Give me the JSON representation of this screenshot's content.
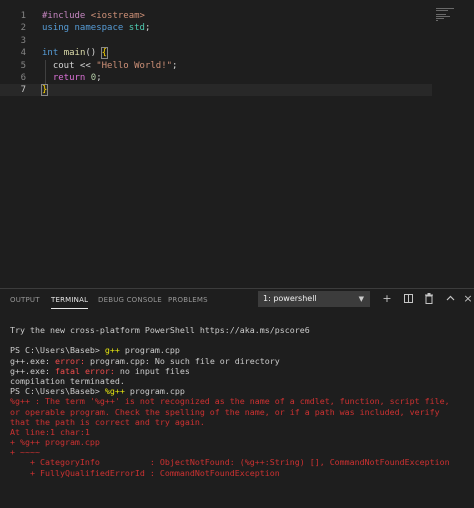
{
  "editor": {
    "lines": [
      {
        "number": "1",
        "segments": [
          {
            "text": "#include ",
            "class": "tok-pre"
          },
          {
            "text": "<iostream>",
            "class": "tok-str"
          }
        ]
      },
      {
        "number": "2",
        "segments": [
          {
            "text": "using ",
            "class": "tok-kw"
          },
          {
            "text": "namespace ",
            "class": "tok-kw"
          },
          {
            "text": "std",
            "class": "tok-ns"
          },
          {
            "text": ";",
            "class": ""
          }
        ]
      },
      {
        "number": "3",
        "segments": []
      },
      {
        "number": "4",
        "segments": [
          {
            "text": "int ",
            "class": "tok-ty"
          },
          {
            "text": "main",
            "class": "tok-fn"
          },
          {
            "text": "() ",
            "class": ""
          },
          {
            "text": "{",
            "class": "tok-br cursor-brace"
          }
        ]
      },
      {
        "number": "5",
        "segments": [
          {
            "text": "  cout << ",
            "class": ""
          },
          {
            "text": "\"Hello World!\"",
            "class": "tok-str"
          },
          {
            "text": ";",
            "class": ""
          }
        ]
      },
      {
        "number": "6",
        "segments": [
          {
            "text": "  return ",
            "class": "tok-br2"
          },
          {
            "text": "0",
            "class": "tok-num"
          },
          {
            "text": ";",
            "class": ""
          }
        ]
      },
      {
        "number": "7",
        "segments": [
          {
            "text": "}",
            "class": "tok-br cursor-brace"
          }
        ]
      }
    ],
    "active_line": "7"
  },
  "panel": {
    "tabs": [
      {
        "id": "output",
        "label": "OUTPUT",
        "active": false
      },
      {
        "id": "terminal",
        "label": "TERMINAL",
        "active": true
      },
      {
        "id": "debug-console",
        "label": "DEBUG CONSOLE",
        "active": false
      },
      {
        "id": "problems",
        "label": "PROBLEMS",
        "active": false
      }
    ],
    "terminal_select": "1: powershell",
    "icons": [
      "chevron-down-icon",
      "add-icon",
      "split-terminal-icon",
      "trash-icon",
      "maximize-icon",
      "close-icon"
    ]
  },
  "terminal": {
    "lines": [
      {
        "segments": [
          {
            "text": "Try the new cross-platform PowerShell https://aka.ms/pscore6",
            "class": ""
          }
        ]
      },
      {
        "segments": [
          {
            "text": "",
            "class": ""
          }
        ]
      },
      {
        "segments": [
          {
            "text": "PS C:\\Users\\Baseb> ",
            "class": ""
          },
          {
            "text": "g++",
            "class": "c-yellow"
          },
          {
            "text": " program.cpp",
            "class": ""
          }
        ]
      },
      {
        "segments": [
          {
            "text": "g++.exe: ",
            "class": ""
          },
          {
            "text": "error: ",
            "class": "c-err"
          },
          {
            "text": "program.cpp: No such file or directory",
            "class": ""
          }
        ]
      },
      {
        "segments": [
          {
            "text": "g++.exe: ",
            "class": ""
          },
          {
            "text": "fatal error: ",
            "class": "c-err"
          },
          {
            "text": "no input files",
            "class": ""
          }
        ]
      },
      {
        "segments": [
          {
            "text": "compilation terminated.",
            "class": ""
          }
        ]
      },
      {
        "segments": [
          {
            "text": "PS C:\\Users\\Baseb> ",
            "class": ""
          },
          {
            "text": "%g++",
            "class": "c-yellow"
          },
          {
            "text": " program.cpp",
            "class": ""
          }
        ]
      },
      {
        "wrap": true,
        "segments": [
          {
            "text": "%g++ : The term '%g++' is not recognized as the name of a cmdlet, function, script file, or operable program. Check the spelling of the name, or if a path was included, verify that the path is correct and try again.",
            "class": "c-red"
          }
        ]
      },
      {
        "segments": [
          {
            "text": "At line:1 char:1",
            "class": "c-red"
          }
        ]
      },
      {
        "segments": [
          {
            "text": "+ %g++ program.cpp",
            "class": "c-red"
          }
        ]
      },
      {
        "segments": [
          {
            "text": "+ ~~~~",
            "class": "c-red"
          }
        ]
      },
      {
        "segments": [
          {
            "text": "    + CategoryInfo          : ObjectNotFound: (%g++:String) [], CommandNotFoundException",
            "class": "c-red"
          }
        ]
      },
      {
        "segments": [
          {
            "text": "    + FullyQualifiedErrorId : CommandNotFoundException",
            "class": "c-red"
          }
        ]
      }
    ]
  }
}
